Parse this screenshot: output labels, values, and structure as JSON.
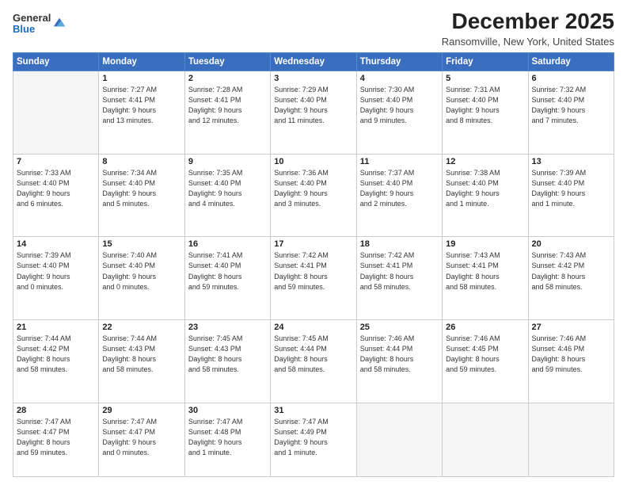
{
  "header": {
    "logo_general": "General",
    "logo_blue": "Blue",
    "month_title": "December 2025",
    "location": "Ransomville, New York, United States"
  },
  "weekdays": [
    "Sunday",
    "Monday",
    "Tuesday",
    "Wednesday",
    "Thursday",
    "Friday",
    "Saturday"
  ],
  "weeks": [
    [
      {
        "day": "",
        "info": ""
      },
      {
        "day": "1",
        "info": "Sunrise: 7:27 AM\nSunset: 4:41 PM\nDaylight: 9 hours\nand 13 minutes."
      },
      {
        "day": "2",
        "info": "Sunrise: 7:28 AM\nSunset: 4:41 PM\nDaylight: 9 hours\nand 12 minutes."
      },
      {
        "day": "3",
        "info": "Sunrise: 7:29 AM\nSunset: 4:40 PM\nDaylight: 9 hours\nand 11 minutes."
      },
      {
        "day": "4",
        "info": "Sunrise: 7:30 AM\nSunset: 4:40 PM\nDaylight: 9 hours\nand 9 minutes."
      },
      {
        "day": "5",
        "info": "Sunrise: 7:31 AM\nSunset: 4:40 PM\nDaylight: 9 hours\nand 8 minutes."
      },
      {
        "day": "6",
        "info": "Sunrise: 7:32 AM\nSunset: 4:40 PM\nDaylight: 9 hours\nand 7 minutes."
      }
    ],
    [
      {
        "day": "7",
        "info": "Sunrise: 7:33 AM\nSunset: 4:40 PM\nDaylight: 9 hours\nand 6 minutes."
      },
      {
        "day": "8",
        "info": "Sunrise: 7:34 AM\nSunset: 4:40 PM\nDaylight: 9 hours\nand 5 minutes."
      },
      {
        "day": "9",
        "info": "Sunrise: 7:35 AM\nSunset: 4:40 PM\nDaylight: 9 hours\nand 4 minutes."
      },
      {
        "day": "10",
        "info": "Sunrise: 7:36 AM\nSunset: 4:40 PM\nDaylight: 9 hours\nand 3 minutes."
      },
      {
        "day": "11",
        "info": "Sunrise: 7:37 AM\nSunset: 4:40 PM\nDaylight: 9 hours\nand 2 minutes."
      },
      {
        "day": "12",
        "info": "Sunrise: 7:38 AM\nSunset: 4:40 PM\nDaylight: 9 hours\nand 1 minute."
      },
      {
        "day": "13",
        "info": "Sunrise: 7:39 AM\nSunset: 4:40 PM\nDaylight: 9 hours\nand 1 minute."
      }
    ],
    [
      {
        "day": "14",
        "info": "Sunrise: 7:39 AM\nSunset: 4:40 PM\nDaylight: 9 hours\nand 0 minutes."
      },
      {
        "day": "15",
        "info": "Sunrise: 7:40 AM\nSunset: 4:40 PM\nDaylight: 9 hours\nand 0 minutes."
      },
      {
        "day": "16",
        "info": "Sunrise: 7:41 AM\nSunset: 4:40 PM\nDaylight: 8 hours\nand 59 minutes."
      },
      {
        "day": "17",
        "info": "Sunrise: 7:42 AM\nSunset: 4:41 PM\nDaylight: 8 hours\nand 59 minutes."
      },
      {
        "day": "18",
        "info": "Sunrise: 7:42 AM\nSunset: 4:41 PM\nDaylight: 8 hours\nand 58 minutes."
      },
      {
        "day": "19",
        "info": "Sunrise: 7:43 AM\nSunset: 4:41 PM\nDaylight: 8 hours\nand 58 minutes."
      },
      {
        "day": "20",
        "info": "Sunrise: 7:43 AM\nSunset: 4:42 PM\nDaylight: 8 hours\nand 58 minutes."
      }
    ],
    [
      {
        "day": "21",
        "info": "Sunrise: 7:44 AM\nSunset: 4:42 PM\nDaylight: 8 hours\nand 58 minutes."
      },
      {
        "day": "22",
        "info": "Sunrise: 7:44 AM\nSunset: 4:43 PM\nDaylight: 8 hours\nand 58 minutes."
      },
      {
        "day": "23",
        "info": "Sunrise: 7:45 AM\nSunset: 4:43 PM\nDaylight: 8 hours\nand 58 minutes."
      },
      {
        "day": "24",
        "info": "Sunrise: 7:45 AM\nSunset: 4:44 PM\nDaylight: 8 hours\nand 58 minutes."
      },
      {
        "day": "25",
        "info": "Sunrise: 7:46 AM\nSunset: 4:44 PM\nDaylight: 8 hours\nand 58 minutes."
      },
      {
        "day": "26",
        "info": "Sunrise: 7:46 AM\nSunset: 4:45 PM\nDaylight: 8 hours\nand 59 minutes."
      },
      {
        "day": "27",
        "info": "Sunrise: 7:46 AM\nSunset: 4:46 PM\nDaylight: 8 hours\nand 59 minutes."
      }
    ],
    [
      {
        "day": "28",
        "info": "Sunrise: 7:47 AM\nSunset: 4:47 PM\nDaylight: 8 hours\nand 59 minutes."
      },
      {
        "day": "29",
        "info": "Sunrise: 7:47 AM\nSunset: 4:47 PM\nDaylight: 9 hours\nand 0 minutes."
      },
      {
        "day": "30",
        "info": "Sunrise: 7:47 AM\nSunset: 4:48 PM\nDaylight: 9 hours\nand 1 minute."
      },
      {
        "day": "31",
        "info": "Sunrise: 7:47 AM\nSunset: 4:49 PM\nDaylight: 9 hours\nand 1 minute."
      },
      {
        "day": "",
        "info": ""
      },
      {
        "day": "",
        "info": ""
      },
      {
        "day": "",
        "info": ""
      }
    ]
  ]
}
